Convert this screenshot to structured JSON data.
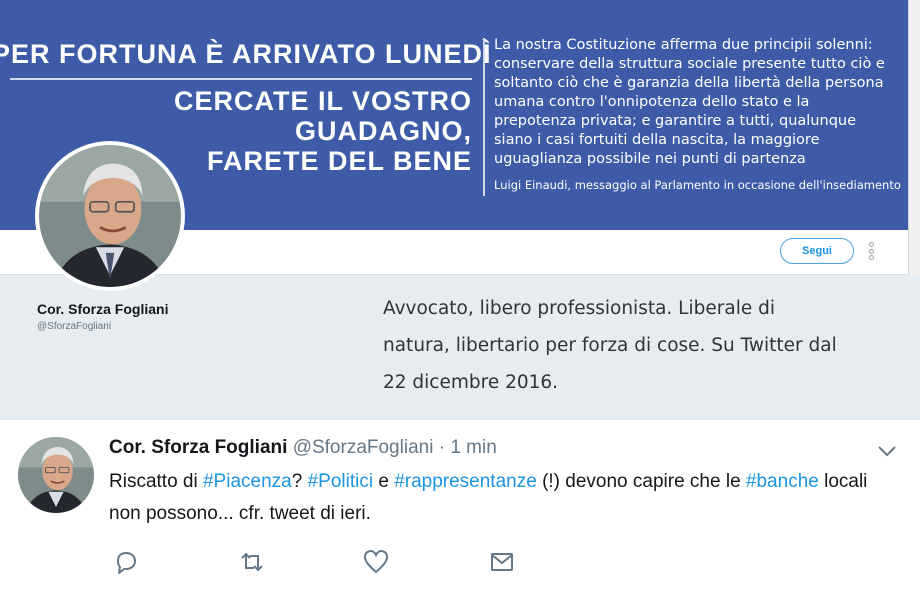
{
  "banner": {
    "title": "PER FORTUNA È ARRIVATO LUNEDÌ",
    "subtitle_line1": "CERCATE IL VOSTRO GUADAGNO,",
    "subtitle_line2": "FARETE DEL BENE",
    "quote": "La nostra Costituzione afferma due principii solenni: conservare della struttura sociale presente tutto ciò e soltanto ciò che è garanzia della libertà della persona umana contro l'onnipotenza dello stato e la prepotenza privata; e garantire a tutti, qualunque siano i casi fortuiti della nascita, la maggiore uguaglianza possibile nei punti di partenza",
    "attribution": "Luigi Einaudi, messaggio al Parlamento in occasione dell'insediamento",
    "background_color": "#3d5ba6"
  },
  "profile": {
    "follow_label": "Segui",
    "more_icon": "more-vertical-icon",
    "name": "Cor. Sforza Fogliani",
    "handle": "@SforzaFogliani",
    "bio": "Avvocato, libero professionista. Liberale di natura, libertario per forza di cose. Su Twitter dal 22 dicembre 2016."
  },
  "tweet": {
    "name": "Cor. Sforza Fogliani",
    "handle": "@SforzaFogliani",
    "separator": "·",
    "time": "1 min",
    "text": {
      "t1": "Riscatto di ",
      "h1": "#Piacenza",
      "t2": "? ",
      "h2": "#Politici",
      "t3": " e ",
      "h3": "#rappresentanze",
      "t4": " (!) devono capire che le ",
      "h4": "#banche",
      "t5": " locali non possono... cfr. tweet di ieri."
    },
    "actions": [
      "reply-icon",
      "retweet-icon",
      "like-icon",
      "message-icon"
    ],
    "hashtag_color": "#1b95e0"
  }
}
